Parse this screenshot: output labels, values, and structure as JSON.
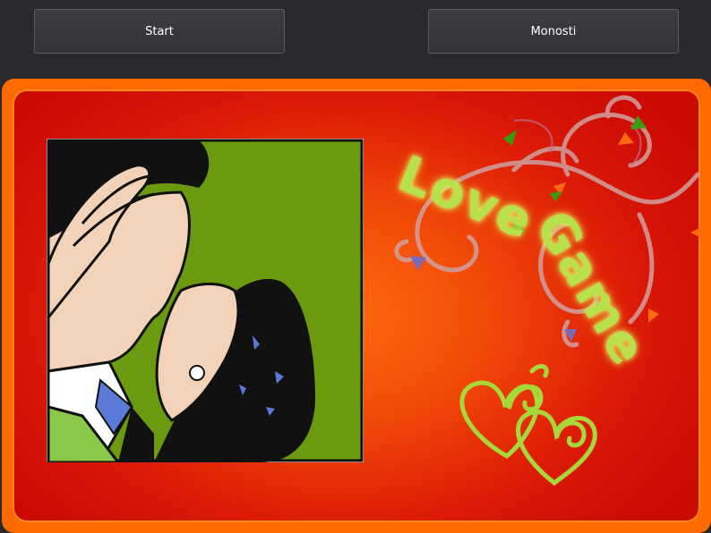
{
  "toolbar": {
    "start_label": "Start",
    "options_label": "Monosti"
  },
  "game": {
    "title_word1": "Love",
    "title_word2": "Game"
  },
  "colors": {
    "frame_orange": "#ff6a00",
    "panel_red": "#cc0a04",
    "title_green": "#b8e04a",
    "comic_green": "#6b9a10"
  },
  "icons": [
    "kissing-couple-illustration",
    "swirl-decoration",
    "heart-icon",
    "double-heart-icon"
  ]
}
